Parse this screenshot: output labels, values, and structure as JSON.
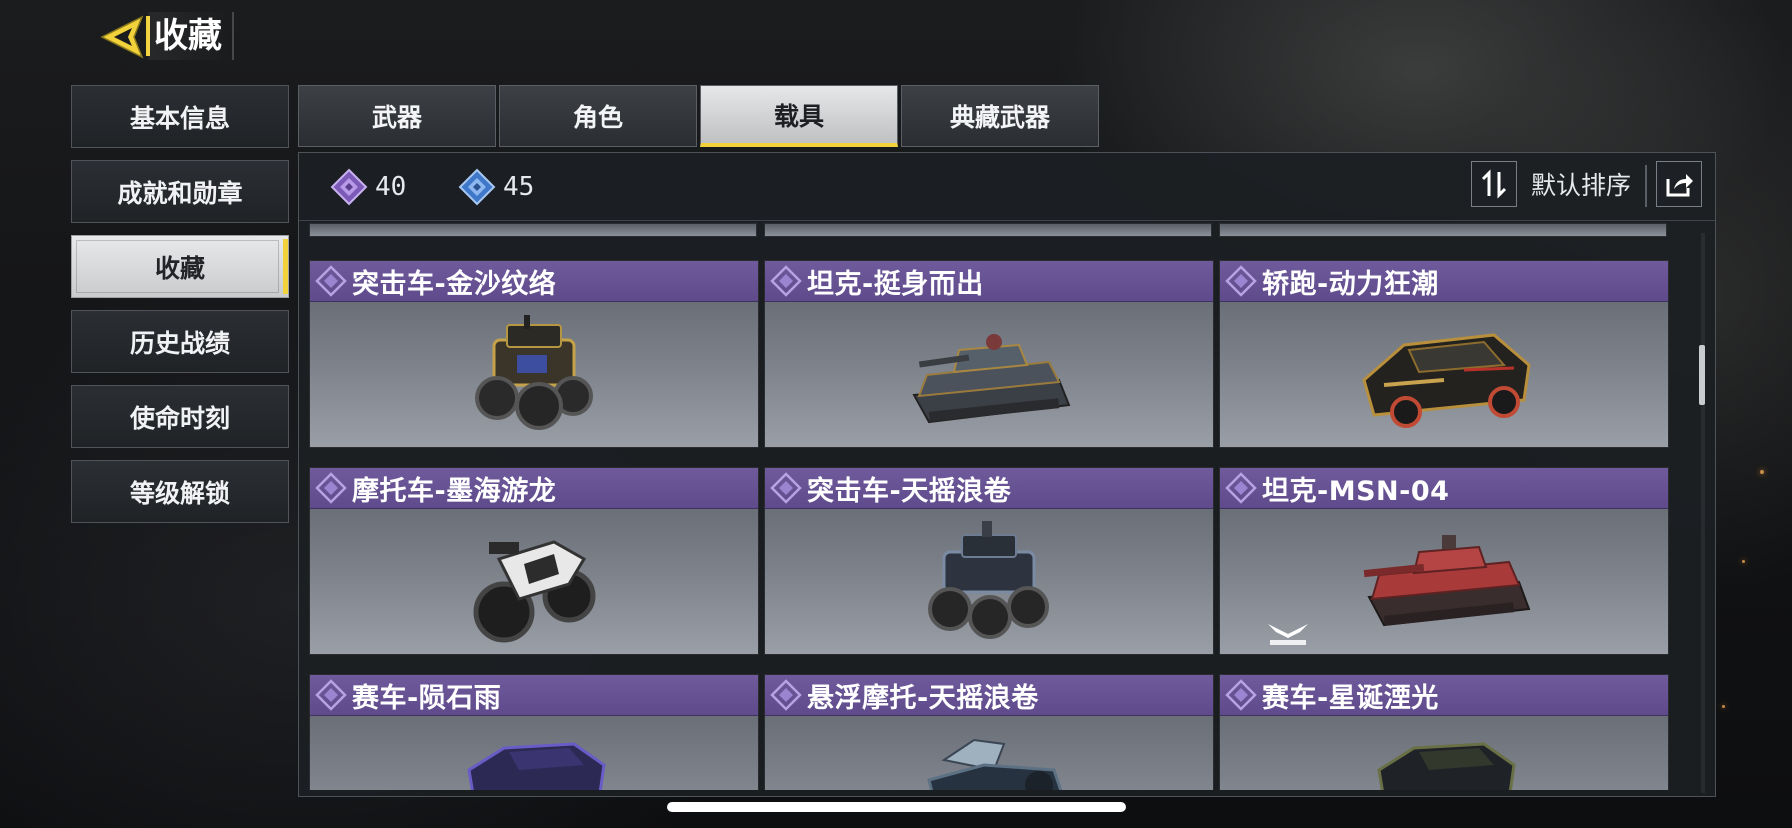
{
  "header": {
    "title": "收藏",
    "back_icon": "back-arrow-icon"
  },
  "nav": {
    "items": [
      {
        "label": "基本信息",
        "active": false
      },
      {
        "label": "成就和勋章",
        "active": false
      },
      {
        "label": "收藏",
        "active": true
      },
      {
        "label": "历史战绩",
        "active": false
      },
      {
        "label": "使命时刻",
        "active": false
      },
      {
        "label": "等级解锁",
        "active": false
      }
    ]
  },
  "tabs": [
    {
      "label": "武器",
      "active": false
    },
    {
      "label": "角色",
      "active": false
    },
    {
      "label": "载具",
      "active": true
    },
    {
      "label": "典藏武器",
      "active": false
    }
  ],
  "toolbar": {
    "stat1": {
      "icon": "purple-diamond-icon",
      "value": "40"
    },
    "stat2": {
      "icon": "blue-diamond-icon",
      "value": "45"
    },
    "sort_label": "默认排序",
    "sort_icon": "sort-arrows-icon",
    "share_icon": "share-icon"
  },
  "vehicles": [
    {
      "name": "突击车-金沙纹络",
      "icon": "buggy-gold-vehicle"
    },
    {
      "name": "坦克-挺身而出",
      "icon": "tank-camo-vehicle"
    },
    {
      "name": "轿跑-动力狂潮",
      "icon": "sports-car-black-gold-vehicle"
    },
    {
      "name": "摩托车-墨海游龙",
      "icon": "motorcycle-white-vehicle"
    },
    {
      "name": "突击车-天摇浪卷",
      "icon": "buggy-blue-vehicle"
    },
    {
      "name": "坦克-MSN-04",
      "icon": "tank-red-vehicle"
    },
    {
      "name": "赛车-陨石雨",
      "icon": "race-car-purple-vehicle"
    },
    {
      "name": "悬浮摩托-天摇浪卷",
      "icon": "hover-bike-vehicle"
    },
    {
      "name": "赛车-星诞湮光",
      "icon": "race-car-dark-vehicle"
    }
  ],
  "colors": {
    "accent_yellow": "#f2d23b",
    "card_header_purple": "#6a559a",
    "active_tab": "#dcdddf"
  }
}
